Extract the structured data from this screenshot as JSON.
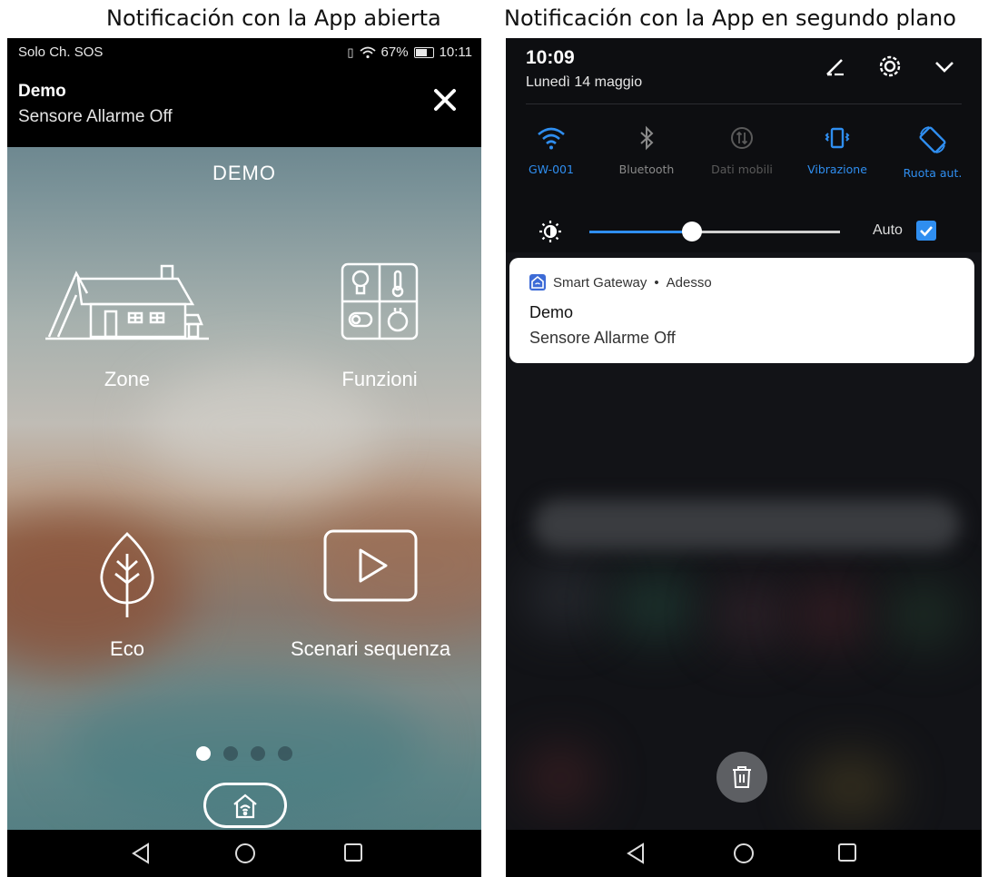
{
  "captions": {
    "left": "Notificación con la App abierta",
    "right": "Notificación con la App en segundo plano"
  },
  "left_phone": {
    "status_bar": {
      "carrier": "Solo Ch. SOS",
      "battery": "67%",
      "time": "10:11"
    },
    "notification": {
      "title": "Demo",
      "body": "Sensore Allarme Off"
    },
    "app_title": "DEMO",
    "tiles": {
      "zone": "Zone",
      "funzioni": "Funzioni",
      "eco": "Eco",
      "scenari": "Scenari sequenza"
    },
    "pager": {
      "pages": 4,
      "active": 1
    },
    "icons": [
      "house-icon",
      "functions-icon",
      "leaf-icon",
      "play-icon",
      "close-icon",
      "home-wifi-icon"
    ]
  },
  "right_phone": {
    "time": "10:09",
    "date": "Lunedì 14 maggio",
    "quick_settings": [
      {
        "label": "GW-001",
        "state": "on",
        "icon": "wifi-icon"
      },
      {
        "label": "Bluetooth",
        "state": "off",
        "icon": "bluetooth-icon"
      },
      {
        "label": "Dati mobili",
        "state": "dim",
        "icon": "mobile-data-icon"
      },
      {
        "label": "Vibrazione",
        "state": "on",
        "icon": "vibrate-icon"
      },
      {
        "label": "Ruota aut.",
        "state": "on",
        "icon": "rotate-icon"
      }
    ],
    "brightness": {
      "level": 0.41,
      "auto_label": "Auto",
      "auto_checked": true
    },
    "notification_card": {
      "app_name": "Smart Gateway",
      "separator": "•",
      "when": "Adesso",
      "title": "Demo",
      "body": "Sensore Allarme Off"
    }
  },
  "colors": {
    "accent_blue": "#2f8ef0",
    "status_bar": "#000000",
    "qs_background": "#0d0e11"
  }
}
